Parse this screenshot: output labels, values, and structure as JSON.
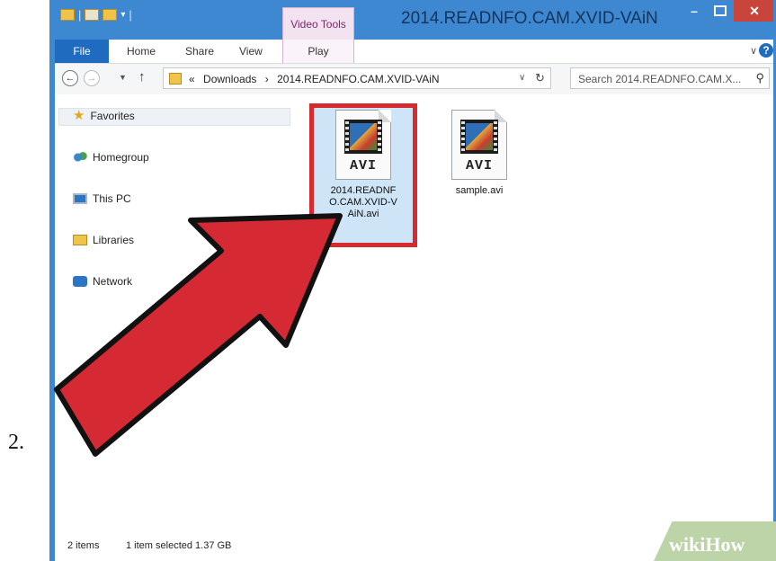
{
  "step_number": "2.",
  "window": {
    "title": "2014.READNFO.CAM.XVID-VAiN",
    "contextual_tab": "Video Tools"
  },
  "ribbon": {
    "tabs": [
      "File",
      "Home",
      "Share",
      "View",
      "Play"
    ]
  },
  "address_bar": {
    "prefix": "«",
    "crumbs": [
      "Downloads",
      "2014.READNFO.CAM.XVID-VAiN"
    ],
    "separator": "›"
  },
  "search": {
    "placeholder": "Search 2014.READNFO.CAM.X..."
  },
  "nav_pane": {
    "items": [
      "Favorites",
      "Homegroup",
      "This PC",
      "Libraries",
      "Network"
    ]
  },
  "files": [
    {
      "ext": "AVI",
      "name": "2014.READNFO.CAM.XVID-VAiN.avi",
      "selected": true
    },
    {
      "ext": "AVI",
      "name": "sample.avi",
      "selected": false
    }
  ],
  "status": {
    "count": "2 items",
    "selection": "1 item selected  1.37 GB"
  },
  "watermark": {
    "text": "wikiHow"
  },
  "colors": {
    "titlebar": "#3e88d1",
    "close": "#c9453b",
    "highlight": "#d62a2f",
    "arrow": "#d52a33",
    "watermark": "#bcd4a8"
  }
}
